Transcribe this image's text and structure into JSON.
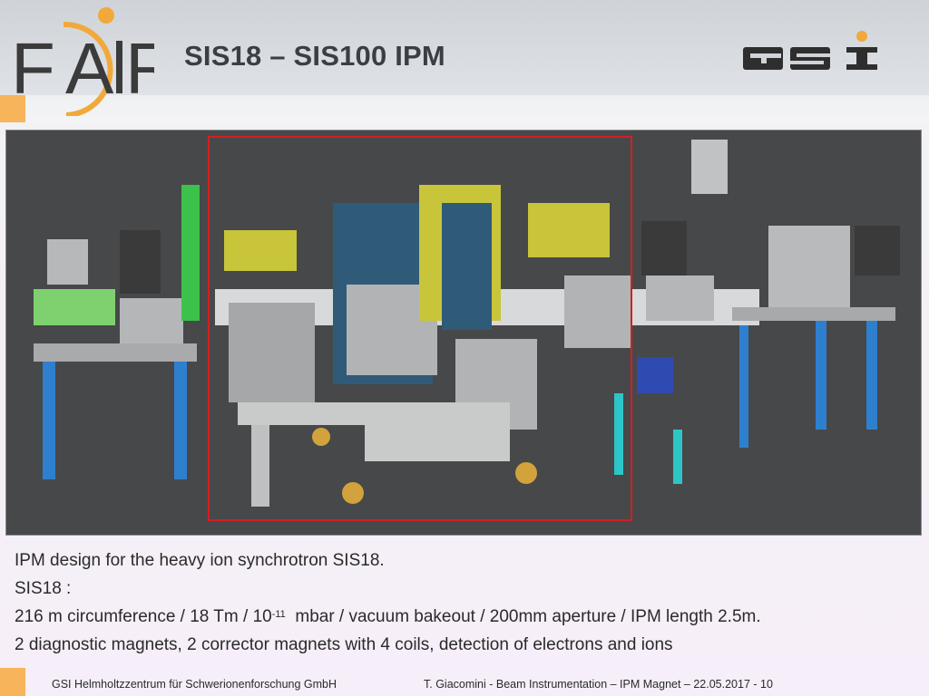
{
  "header": {
    "title": "SIS18 – SIS100 IPM",
    "logo_left": "FAIR",
    "logo_right": "GSI"
  },
  "colors": {
    "accent_orange": "#f7b45a",
    "highlight_red": "#d41e22",
    "title_gray": "#3a3f46"
  },
  "figure": {
    "icon": "accelerator-beamline-render",
    "highlight": "red-rectangle"
  },
  "body": {
    "line1": "IPM design for the heavy ion synchrotron SIS18.",
    "line2": "SIS18 :",
    "line3_pre": "216 m circumference / 18 Tm / 10",
    "line3_sup": "-11",
    "line3_post": "  mbar / vacuum bakeout / 200mm aperture / IPM length 2.5m.",
    "line4": "2 diagnostic magnets, 2 corrector magnets with 4 coils, detection of electrons and ions"
  },
  "footer": {
    "left": "GSI Helmholtzzentrum für Schwerionenforschung GmbH",
    "right": "T. Giacomini - Beam Instrumentation – IPM Magnet – 22.05.2017 - 10"
  }
}
